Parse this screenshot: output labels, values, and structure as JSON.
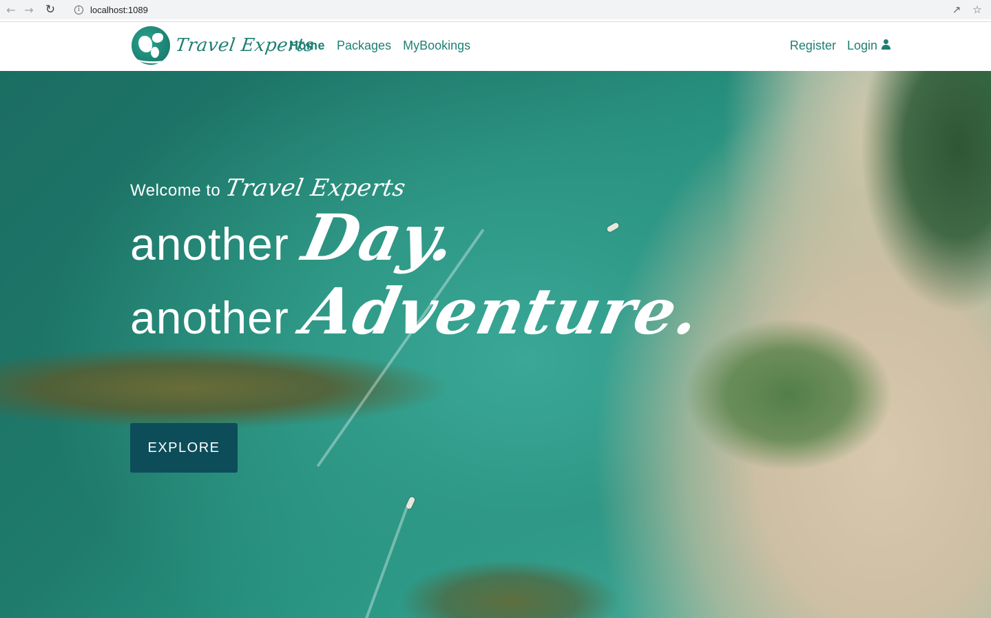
{
  "browser": {
    "url": "localhost:1089",
    "back_icon": "arrow-left-icon",
    "forward_icon": "arrow-right-icon",
    "reload_icon": "reload-icon"
  },
  "navbar": {
    "brand_name": "Travel Experts",
    "links": [
      {
        "label": "Home",
        "active": true
      },
      {
        "label": "Packages",
        "active": false
      },
      {
        "label": "MyBookings",
        "active": false
      }
    ],
    "register_label": "Register",
    "login_label": "Login"
  },
  "hero": {
    "welcome_text": "Welcome to",
    "welcome_brand": "Travel Experts",
    "line1_plain": "another",
    "line1_script": "Day.",
    "line2_plain": "another",
    "line2_script": "Adventure.",
    "explore_label": "EXPLORE"
  },
  "colors": {
    "brand_teal": "#1e7f72",
    "button_bg": "#0d4d5a"
  }
}
